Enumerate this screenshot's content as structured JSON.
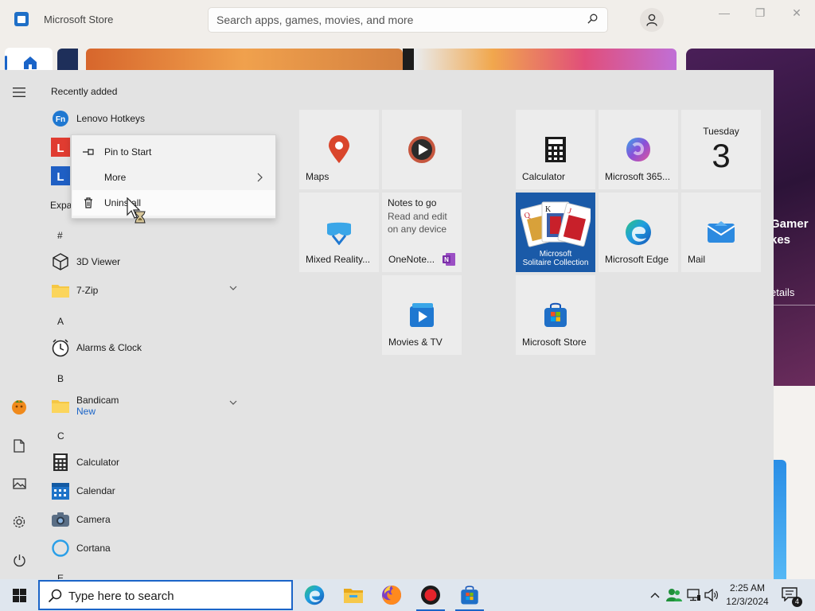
{
  "store": {
    "title": "Microsoft Store",
    "search_placeholder": "Search apps, games, movies, and more",
    "hero_text": "Gamer",
    "hero_text2": "kes",
    "hero_details": "etails"
  },
  "start_menu": {
    "recently_added_label": "Recently added",
    "expand_label": "Expa",
    "recent_apps": [
      {
        "label": "Lenovo Hotkeys"
      }
    ],
    "groups": {
      "hash": "#",
      "a": "A",
      "b": "B",
      "c": "C",
      "e": "E"
    },
    "apps": {
      "viewer3d": "3D Viewer",
      "zip7": "7-Zip",
      "alarms": "Alarms & Clock",
      "bandicam": "Bandicam",
      "bandicam_badge": "New",
      "calculator": "Calculator",
      "calendar": "Calendar",
      "camera": "Camera",
      "cortana": "Cortana"
    },
    "context_menu": {
      "pin": "Pin to Start",
      "more": "More",
      "uninstall": "Uninstall"
    },
    "tiles": {
      "maps": "Maps",
      "notes_title": "Notes to go",
      "notes_desc_1": "Read and edit",
      "notes_desc_2": "on any device",
      "mixed_reality": "Mixed Reality...",
      "onenote": "OneNote...",
      "movies": "Movies & TV",
      "calculator": "Calculator",
      "m365": "Microsoft 365...",
      "calendar_day": "Tuesday",
      "calendar_date": "3",
      "solitaire_1": "Microsoft",
      "solitaire_2": "Solitaire Collection",
      "edge": "Microsoft Edge",
      "mail": "Mail",
      "store": "Microsoft Store"
    }
  },
  "taskbar": {
    "search_placeholder": "Type here to search",
    "time": "2:25 AM",
    "date": "12/3/2024",
    "notification_count": "4"
  },
  "colors": {
    "accent": "#1a64c8",
    "start_bg": "#e3e3e3",
    "tile_bg": "#ececec",
    "taskbar_bg": "#dfe6ee"
  }
}
